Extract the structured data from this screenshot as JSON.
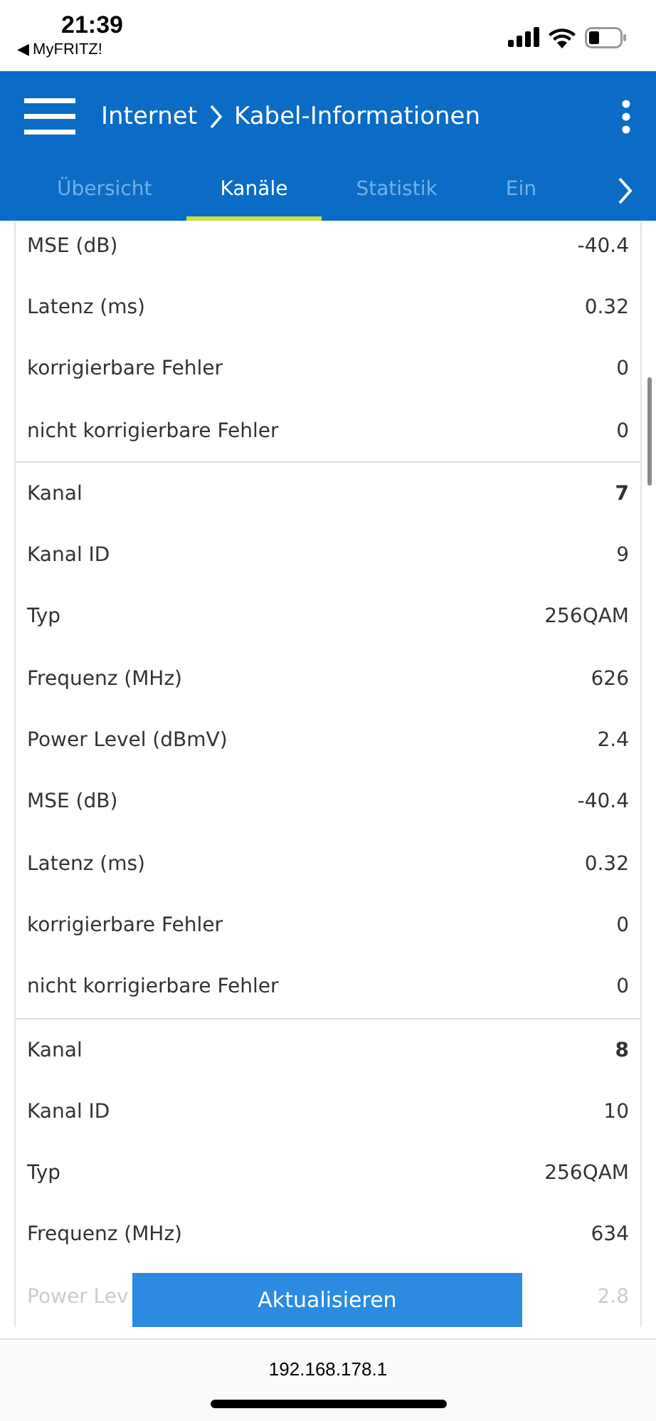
{
  "status_bar": {
    "time": "21:39",
    "back_label": "◀ MyFRITZ!"
  },
  "header": {
    "title": "Internet",
    "subtitle": "Kabel-Informationen"
  },
  "tabs": [
    {
      "label": "Übersicht",
      "selected": false
    },
    {
      "label": "Kanäle",
      "selected": true
    },
    {
      "label": "Statistik",
      "selected": false
    },
    {
      "label": "Ein",
      "selected": false
    }
  ],
  "groups": [
    [
      {
        "kind": "param",
        "label": "MSE (dB)",
        "value": "-40.4"
      },
      {
        "kind": "param",
        "label": "Latenz (ms)",
        "value": "0.32"
      },
      {
        "kind": "param",
        "label": "korrigierbare Fehler",
        "value": "0"
      },
      {
        "kind": "param",
        "label": "nicht korrigierbare Fehler",
        "value": "0"
      }
    ],
    [
      {
        "kind": "channel",
        "label": "Kanal",
        "value": "7"
      },
      {
        "kind": "param",
        "label": "Kanal ID",
        "value": "9"
      },
      {
        "kind": "param",
        "label": "Typ",
        "value": "256QAM"
      },
      {
        "kind": "param",
        "label": "Frequenz (MHz)",
        "value": "626"
      },
      {
        "kind": "param",
        "label": "Power Level (dBmV)",
        "value": "2.4"
      },
      {
        "kind": "param",
        "label": "MSE (dB)",
        "value": "-40.4"
      },
      {
        "kind": "param",
        "label": "Latenz (ms)",
        "value": "0.32"
      },
      {
        "kind": "param",
        "label": "korrigierbare Fehler",
        "value": "0"
      },
      {
        "kind": "param",
        "label": "nicht korrigierbare Fehler",
        "value": "0"
      }
    ],
    [
      {
        "kind": "channel",
        "label": "Kanal",
        "value": "8"
      },
      {
        "kind": "param",
        "label": "Kanal ID",
        "value": "10"
      },
      {
        "kind": "param",
        "label": "Typ",
        "value": "256QAM"
      },
      {
        "kind": "param",
        "label": "Frequenz (MHz)",
        "value": "634"
      },
      {
        "kind": "faded",
        "label": "Power Lev",
        "value": "2.8"
      }
    ]
  ],
  "refresh_button": "Aktualisieren",
  "address_bar": {
    "url": "192.168.178.1"
  }
}
